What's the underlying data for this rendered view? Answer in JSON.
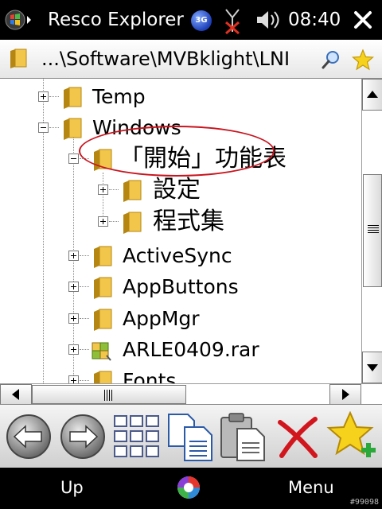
{
  "status_bar": {
    "app_title": "Resco Explorer",
    "network_badge": "3G",
    "time": "08:40",
    "icons": [
      "windows-flag-icon",
      "3g-icon",
      "signal-icon",
      "volume-icon",
      "close-icon"
    ]
  },
  "path_bar": {
    "path": "...\\Software\\MVBklight\\LNI",
    "icons": [
      "folder-icon",
      "search-icon",
      "favorite-star-icon"
    ]
  },
  "tree": {
    "items": [
      {
        "label": "Temp",
        "icon": "folder-icon",
        "expander": "plus"
      },
      {
        "label": "Windows",
        "icon": "folder-icon",
        "expander": "minus"
      },
      {
        "label": "「開始」功能表",
        "icon": "folder-icon",
        "expander": "minus"
      },
      {
        "label": "設定",
        "icon": "folder-icon",
        "expander": "plus"
      },
      {
        "label": "程式集",
        "icon": "folder-icon",
        "expander": "plus",
        "highlighted": true
      },
      {
        "label": "ActiveSync",
        "icon": "folder-icon",
        "expander": "plus"
      },
      {
        "label": "AppButtons",
        "icon": "folder-icon",
        "expander": "plus"
      },
      {
        "label": "AppMgr",
        "icon": "folder-icon",
        "expander": "plus"
      },
      {
        "label": "ARLE0409.rar",
        "icon": "archive-icon",
        "expander": "plus"
      },
      {
        "label": "Fonts",
        "icon": "folder-icon",
        "expander": "plus"
      }
    ],
    "highlight_color": "#c8141e"
  },
  "toolbar": {
    "buttons": [
      "back-button",
      "forward-button",
      "view-grid-button",
      "copy-button",
      "paste-button",
      "delete-button",
      "add-favorite-button"
    ]
  },
  "soft_keys": {
    "left": "Up",
    "right": "Menu",
    "watermark": "#99098"
  },
  "colors": {
    "folder": "#f2c64a",
    "folder_dark": "#b58712",
    "delete": "#d2161e",
    "star": "#f7d21c",
    "plus": "#2aa83a"
  }
}
